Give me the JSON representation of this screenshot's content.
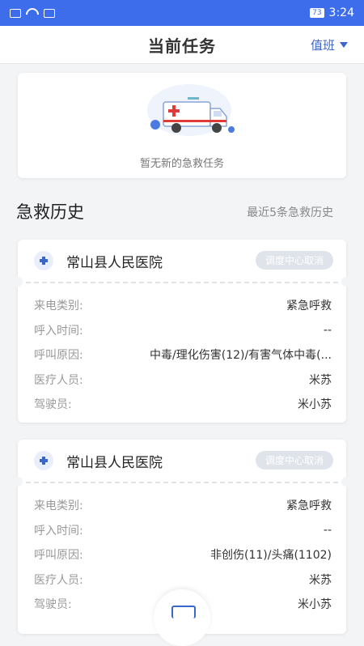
{
  "status": {
    "time": "3:24",
    "battery": "73"
  },
  "header": {
    "title": "当前任务",
    "duty": "值班"
  },
  "empty": {
    "text": "暂无新的急救任务"
  },
  "history": {
    "title": "急救历史",
    "subtitle": "最近5条急救历史",
    "labels": {
      "call_type": "来电类别:",
      "call_time": "呼入时间:",
      "reason": "呼叫原因:",
      "medic": "医疗人员:",
      "driver": "驾驶员:"
    },
    "records": [
      {
        "hospital": "常山县人民医院",
        "status": "调度中心取消",
        "call_type": "紧急呼救",
        "call_time": "--",
        "reason": "中毒/理化伤害(12)/有害气体中毒(...",
        "medic": "米苏",
        "driver": "米小苏"
      },
      {
        "hospital": "常山县人民医院",
        "status": "调度中心取消",
        "call_type": "紧急呼救",
        "call_time": "--",
        "reason": "非创伤(11)/头痛(1102)",
        "medic": "米苏",
        "driver": "米小苏"
      }
    ]
  },
  "colors": {
    "primary": "#3d6dea",
    "link": "#3a66c9"
  },
  "icons": [
    "wifi-icon",
    "ambulance-icon",
    "hospital-cross-icon",
    "dropdown-triangle-icon"
  ]
}
